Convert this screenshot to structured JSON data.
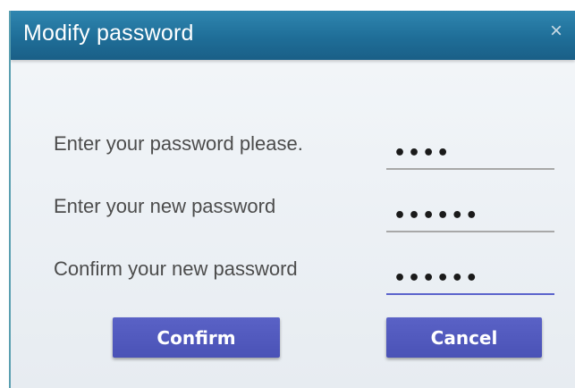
{
  "dialog": {
    "title": "Modify password",
    "close_glyph": "×",
    "fields": [
      {
        "label": "Enter your password please.",
        "value": "••••"
      },
      {
        "label": "Enter your new password",
        "value": "••••••"
      },
      {
        "label": "Confirm your new password",
        "value": "••••••"
      }
    ],
    "buttons": {
      "confirm": "Confirm",
      "cancel": "Cancel"
    }
  },
  "colors": {
    "titlebar": "#1f6e98",
    "button": "#4a52b6",
    "focused_underline": "#5b63cc"
  },
  "icons": {
    "close": "close-icon"
  }
}
